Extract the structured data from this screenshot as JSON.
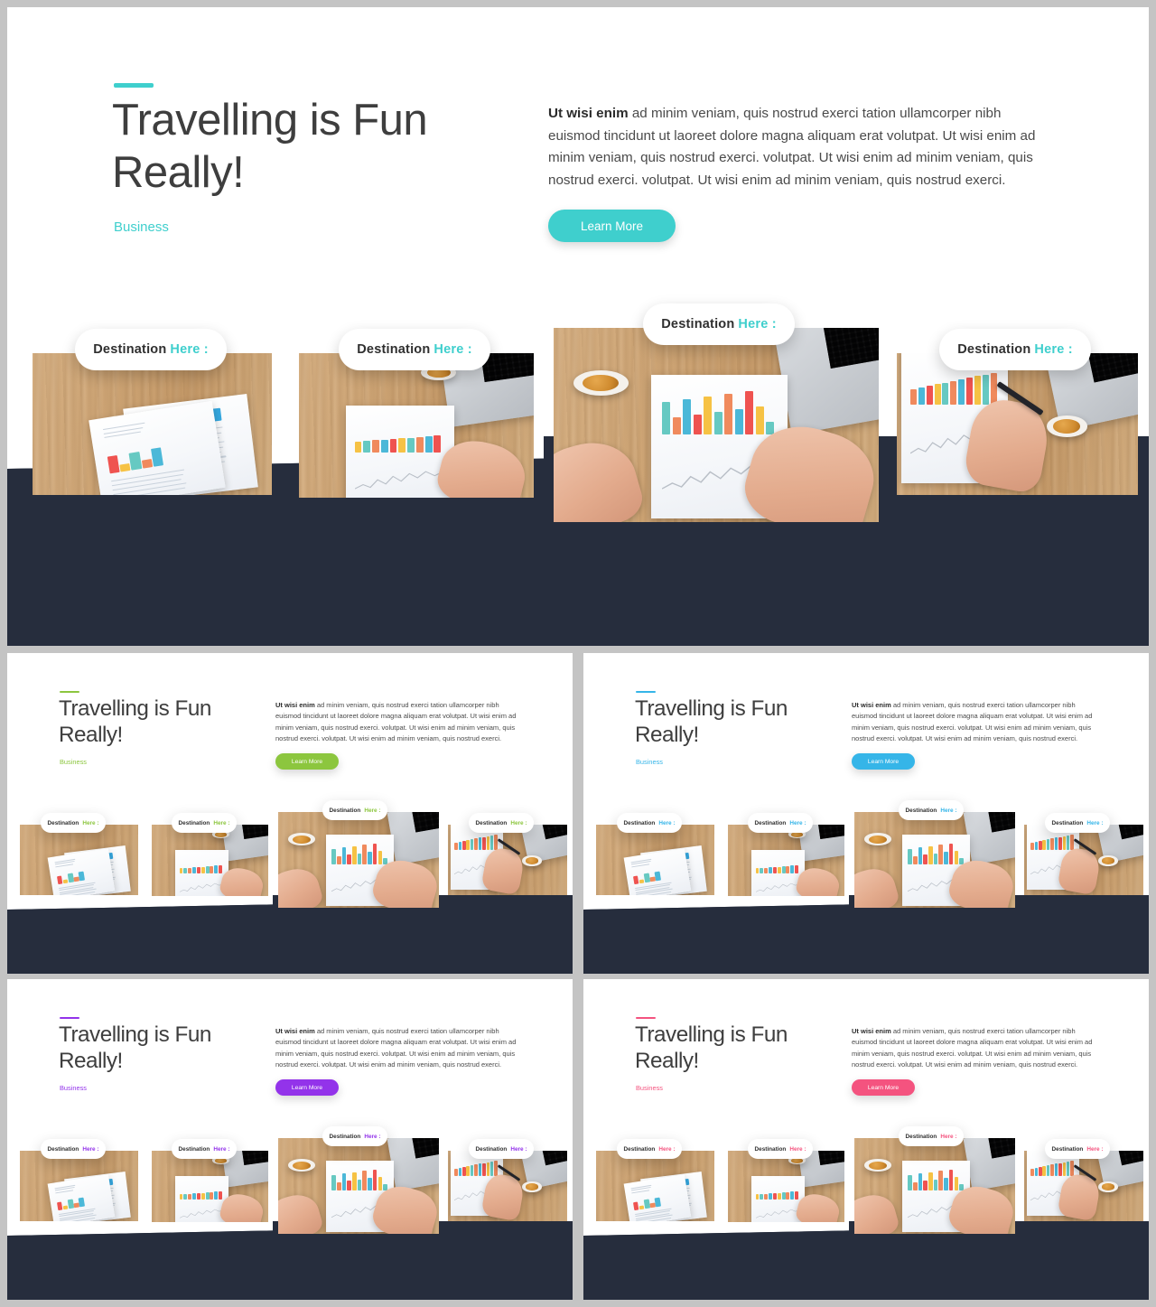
{
  "page": {
    "background": "#c4c4c4",
    "slide_background": "#ffffff",
    "navy_panel": "#262d3d"
  },
  "slides": [
    {
      "id": "hero",
      "variant": "teal",
      "accent": "#3fcfcd",
      "accent_rule_name": "accent-rule",
      "headline": "Travelling is Fun\nReally!",
      "kicker": "Business",
      "body_lead": "Ut wisi enim",
      "body_rest": " ad minim veniam, quis nostrud exerci tation ullamcorper nibh euismod tincidunt ut laoreet dolore magna aliquam erat volutpat. Ut wisi enim ad minim veniam, quis nostrud exerci. volutpat. Ut wisi enim ad minim veniam, quis nostrud exerci. volutpat. Ut wisi enim ad minim veniam, quis nostrud exerci.",
      "cta_label": "Learn More",
      "cards": [
        {
          "label_main": "Destination",
          "label_accent": "Here :",
          "scene": "documents"
        },
        {
          "label_main": "Destination",
          "label_accent": "Here :",
          "scene": "chart-hand"
        },
        {
          "label_main": "Destination",
          "label_accent": "Here :",
          "scene": "two-hands"
        },
        {
          "label_main": "Destination",
          "label_accent": "Here :",
          "scene": "writing"
        }
      ]
    },
    {
      "id": "green",
      "variant": "green",
      "accent": "#8cc63e",
      "headline": "Travelling is Fun\nReally!",
      "kicker": "Business",
      "body_lead": "Ut wisi enim",
      "body_rest": " ad minim veniam, quis nostrud exerci tation ullamcorper nibh euismod tincidunt ut laoreet dolore magna aliquam erat volutpat. Ut wisi enim ad minim veniam, quis nostrud exerci. volutpat. Ut wisi enim ad minim veniam, quis nostrud exerci. volutpat. Ut wisi enim ad minim veniam, quis nostrud exerci.",
      "cta_label": "Learn More",
      "cards": [
        {
          "label_main": "Destination",
          "label_accent": "Here :",
          "scene": "documents"
        },
        {
          "label_main": "Destination",
          "label_accent": "Here :",
          "scene": "chart-hand"
        },
        {
          "label_main": "Destination",
          "label_accent": "Here :",
          "scene": "two-hands"
        },
        {
          "label_main": "Destination",
          "label_accent": "Here :",
          "scene": "writing"
        }
      ]
    },
    {
      "id": "blue",
      "variant": "blue",
      "accent": "#35b5e8",
      "headline": "Travelling is Fun\nReally!",
      "kicker": "Business",
      "body_lead": "Ut wisi enim",
      "body_rest": " ad minim veniam, quis nostrud exerci tation ullamcorper nibh euismod tincidunt ut laoreet dolore magna aliquam erat volutpat. Ut wisi enim ad minim veniam, quis nostrud exerci. volutpat. Ut wisi enim ad minim veniam, quis nostrud exerci. volutpat. Ut wisi enim ad minim veniam, quis nostrud exerci.",
      "cta_label": "Learn More",
      "cards": [
        {
          "label_main": "Destination",
          "label_accent": "Here :",
          "scene": "documents"
        },
        {
          "label_main": "Destination",
          "label_accent": "Here :",
          "scene": "chart-hand"
        },
        {
          "label_main": "Destination",
          "label_accent": "Here :",
          "scene": "two-hands"
        },
        {
          "label_main": "Destination",
          "label_accent": "Here :",
          "scene": "writing"
        }
      ]
    },
    {
      "id": "purple",
      "variant": "purple",
      "accent": "#9333ea",
      "headline": "Travelling is Fun\nReally!",
      "kicker": "Business",
      "body_lead": "Ut wisi enim",
      "body_rest": " ad minim veniam, quis nostrud exerci tation ullamcorper nibh euismod tincidunt ut laoreet dolore magna aliquam erat volutpat. Ut wisi enim ad minim veniam, quis nostrud exerci. volutpat. Ut wisi enim ad minim veniam, quis nostrud exerci. volutpat. Ut wisi enim ad minim veniam, quis nostrud exerci.",
      "cta_label": "Learn More",
      "cards": [
        {
          "label_main": "Destination",
          "label_accent": "Here :",
          "scene": "documents"
        },
        {
          "label_main": "Destination",
          "label_accent": "Here :",
          "scene": "chart-hand"
        },
        {
          "label_main": "Destination",
          "label_accent": "Here :",
          "scene": "two-hands"
        },
        {
          "label_main": "Destination",
          "label_accent": "Here :",
          "scene": "writing"
        }
      ]
    },
    {
      "id": "pink",
      "variant": "pink",
      "accent": "#f4537f",
      "headline": "Travelling is Fun\nReally!",
      "kicker": "Business",
      "body_lead": "Ut wisi enim",
      "body_rest": " ad minim veniam, quis nostrud exerci tation ullamcorper nibh euismod tincidunt ut laoreet dolore magna aliquam erat volutpat. Ut wisi enim ad minim veniam, quis nostrud exerci. volutpat. Ut wisi enim ad minim veniam, quis nostrud exerci. volutpat. Ut wisi enim ad minim veniam, quis nostrud exerci.",
      "cta_label": "Learn More",
      "cards": [
        {
          "label_main": "Destination",
          "label_accent": "Here :",
          "scene": "documents"
        },
        {
          "label_main": "Destination",
          "label_accent": "Here :",
          "scene": "chart-hand"
        },
        {
          "label_main": "Destination",
          "label_accent": "Here :",
          "scene": "two-hands"
        },
        {
          "label_main": "Destination",
          "label_accent": "Here :",
          "scene": "writing"
        }
      ]
    }
  ],
  "photo_chart_colors": [
    "#4bb8d8",
    "#ef5350",
    "#f6c244",
    "#66c9c2",
    "#f08a5d"
  ]
}
